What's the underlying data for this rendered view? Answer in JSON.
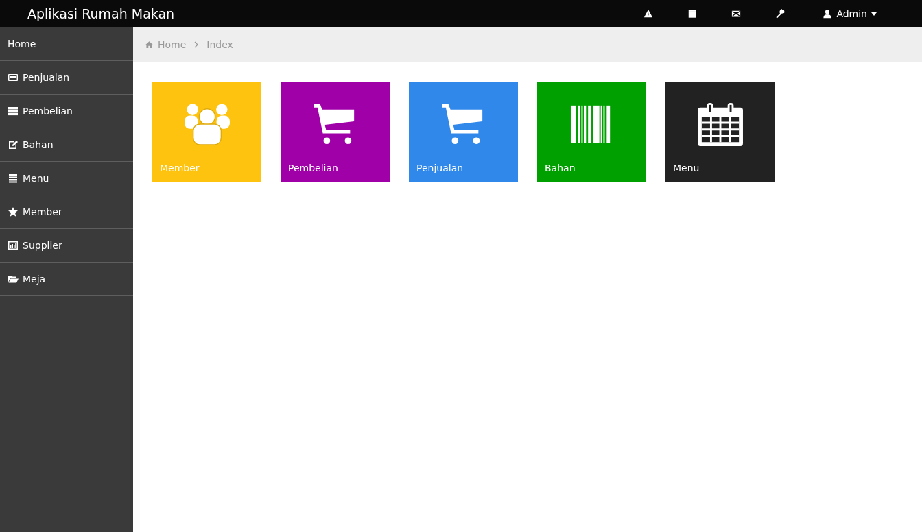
{
  "navbar": {
    "title": "Aplikasi Rumah Makan",
    "icons": [
      {
        "kind": "warning"
      },
      {
        "kind": "list"
      },
      {
        "kind": "mail"
      },
      {
        "kind": "wrench"
      }
    ],
    "user": "Admin"
  },
  "sidebar": {
    "items": [
      {
        "label": "Home",
        "kind": "none"
      },
      {
        "label": "Penjualan",
        "kind": "card"
      },
      {
        "label": "Pembelian",
        "kind": "server"
      },
      {
        "label": "Bahan",
        "kind": "edit"
      },
      {
        "label": "Menu",
        "kind": "list"
      },
      {
        "label": "Member",
        "kind": "star"
      },
      {
        "label": "Supplier",
        "kind": "chart"
      },
      {
        "label": "Meja",
        "kind": "folder"
      }
    ]
  },
  "breadcrumb": [
    "Home",
    "Index"
  ],
  "tiles": [
    {
      "label": "Member",
      "kind": "people",
      "color": "#fdc30f"
    },
    {
      "label": "Pembelian",
      "kind": "cart",
      "color": "#a000a8"
    },
    {
      "label": "Penjualan",
      "kind": "cart",
      "color": "#2f88ea"
    },
    {
      "label": "Bahan",
      "kind": "barcode",
      "color": "#00a000"
    },
    {
      "label": "Menu",
      "kind": "calendar",
      "color": "#222222"
    }
  ]
}
